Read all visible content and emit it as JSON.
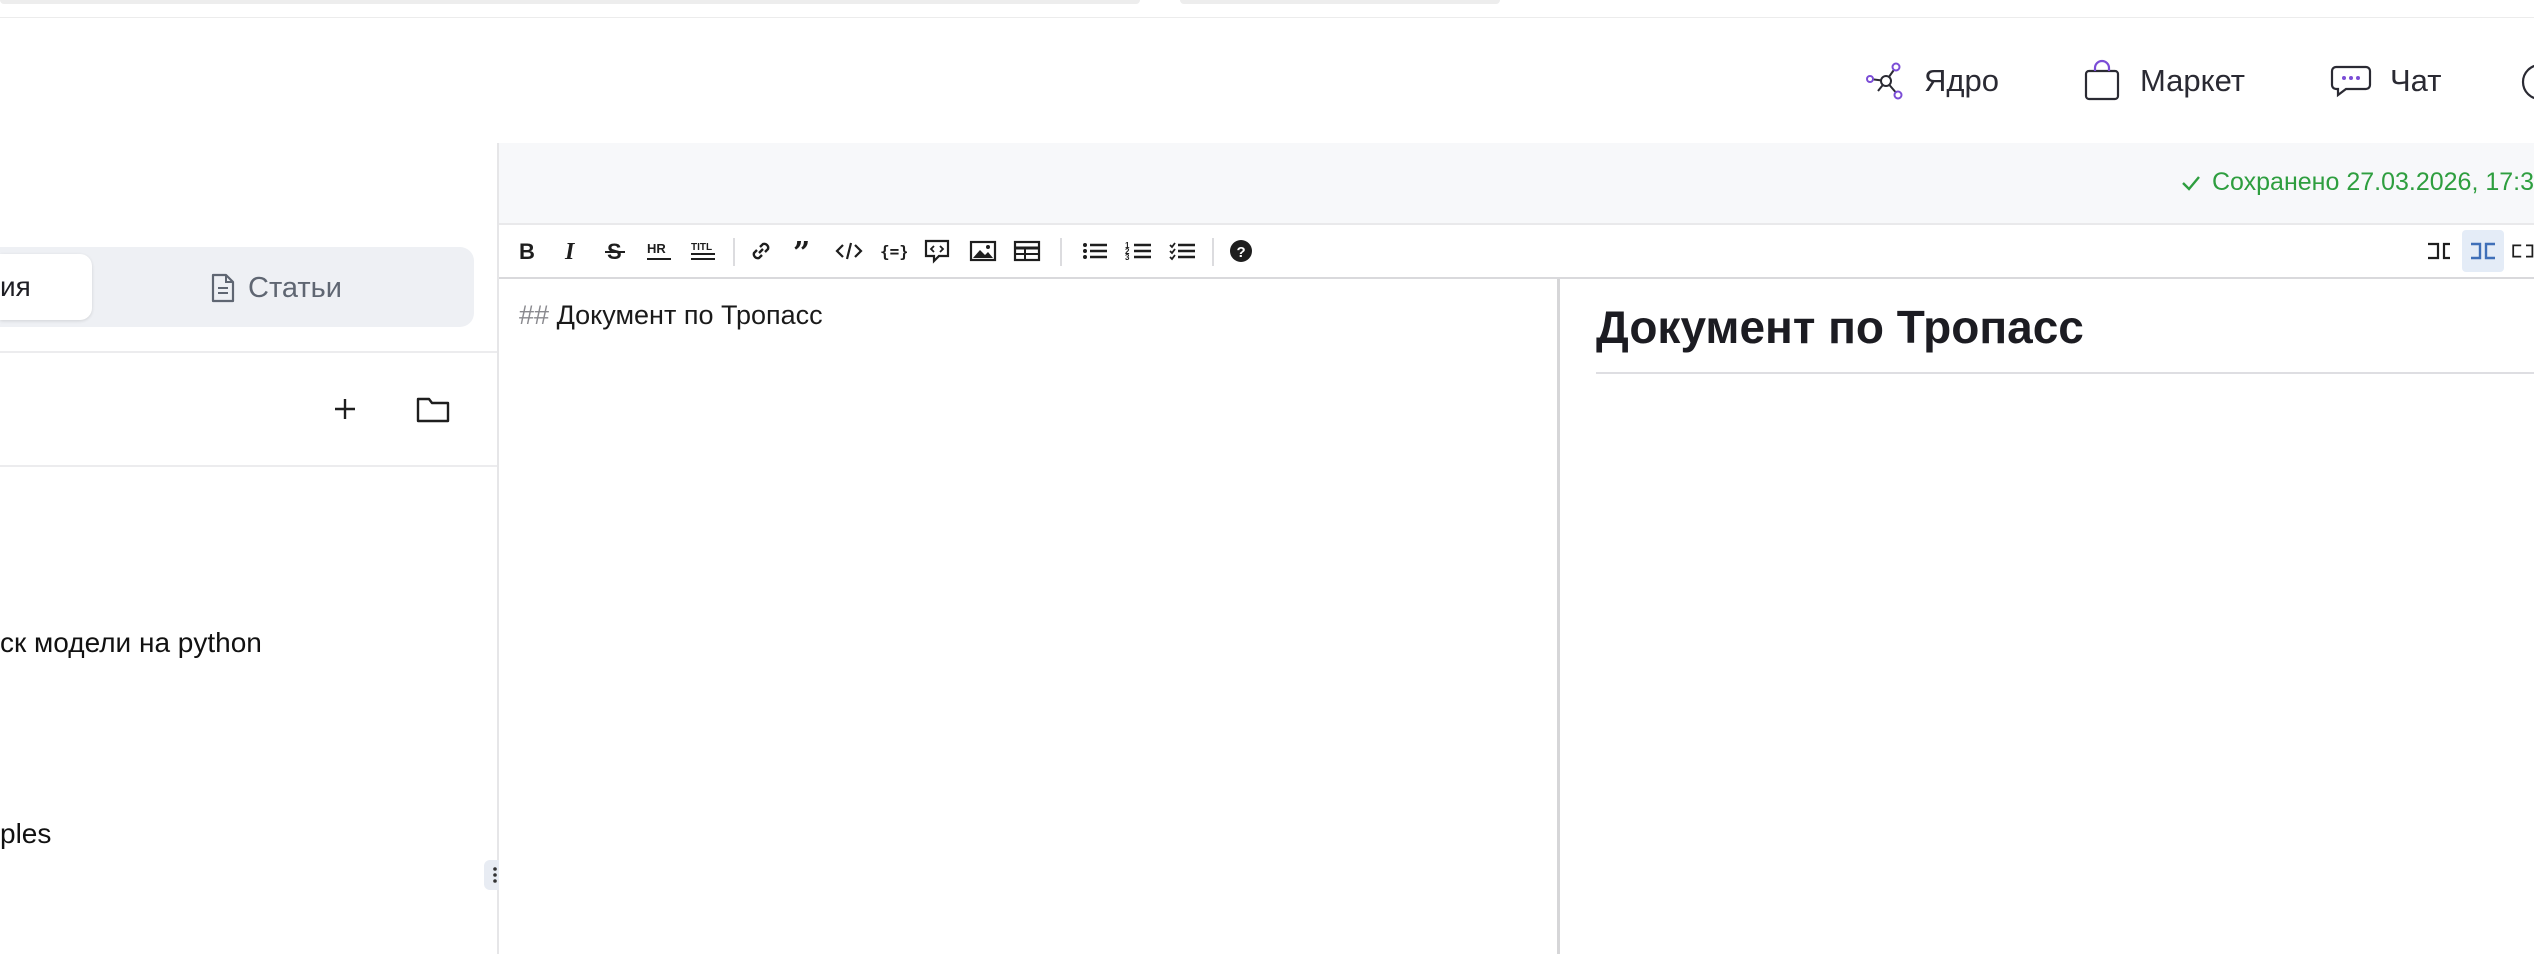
{
  "nav": {
    "items": [
      {
        "label": "Ядро",
        "icon": "network-node-icon"
      },
      {
        "label": "Маркет",
        "icon": "shopping-bag-icon"
      },
      {
        "label": "Чат",
        "icon": "chat-bubble-icon"
      }
    ]
  },
  "sidebar": {
    "tabs": {
      "active_label": "ия",
      "articles_label": "Статьи"
    },
    "tree_items": [
      "ск модели на python",
      "ples"
    ]
  },
  "editor": {
    "saved_status": "Сохранено 27.03.2026, 17:3",
    "markdown_prefix": "##",
    "markdown_text": "Документ по Тропасс",
    "preview_heading": "Документ по Тропасс"
  },
  "colors": {
    "saved_green": "#2e9e3f",
    "accent_purple": "#7b4dd6",
    "active_mode_bg": "#e4ecf7"
  }
}
